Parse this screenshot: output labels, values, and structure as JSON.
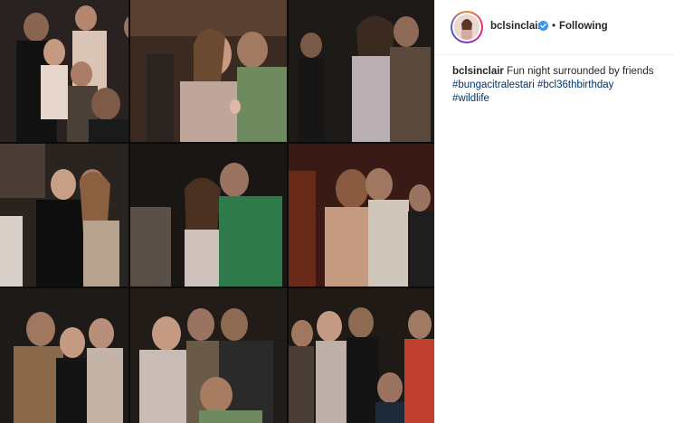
{
  "post": {
    "username": "bclsinclair",
    "following_label": "Following",
    "separator": "•",
    "caption_user": "bclsinclair",
    "caption_text": "Fun night surrounded by friends",
    "hashtags": [
      "#bungacitralestari",
      "#bcl36thbirthday",
      "#wildlife"
    ]
  },
  "icons": {
    "verified": "verified-badge-icon",
    "avatar": "profile-avatar"
  },
  "colors": {
    "link": "#003569",
    "verified": "#3897f0",
    "text": "#262626",
    "border": "#efefef"
  }
}
